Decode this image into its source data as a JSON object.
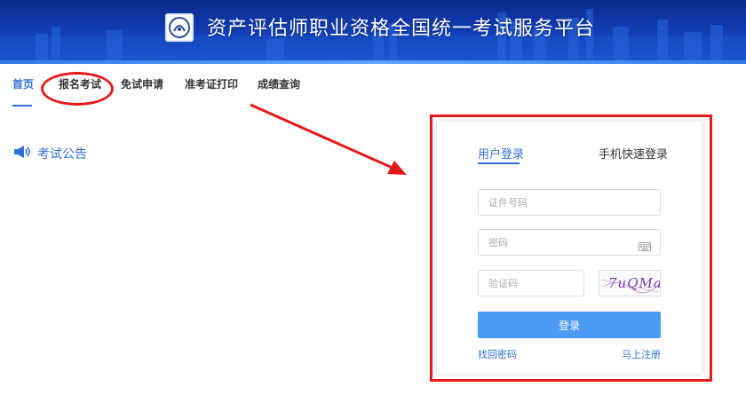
{
  "header": {
    "title": "资产评估师职业资格全国统一考试服务平台",
    "logo_icon": "association-logo-icon"
  },
  "nav": {
    "items": [
      {
        "label": "首页",
        "active": true
      },
      {
        "label": "报名考试",
        "active": false
      },
      {
        "label": "免试申请",
        "active": false
      },
      {
        "label": "准考证打印",
        "active": false
      },
      {
        "label": "成绩查询",
        "active": false
      }
    ]
  },
  "announcement": {
    "label": "考试公告",
    "icon": "megaphone-icon"
  },
  "login": {
    "tabs": [
      {
        "label": "用户登录",
        "active": true
      },
      {
        "label": "手机快速登录",
        "active": false
      }
    ],
    "id_placeholder": "证件号码",
    "password_placeholder": "密码",
    "captcha_placeholder": "验证码",
    "captcha_text": "7uQMa",
    "submit_label": "登录",
    "forgot_label": "找回密码",
    "register_label": "马上注册"
  },
  "colors": {
    "accent": "#2f6fd6",
    "button": "#4b9bf5",
    "annotation": "#e51a1a",
    "banner": "#123fb8"
  }
}
